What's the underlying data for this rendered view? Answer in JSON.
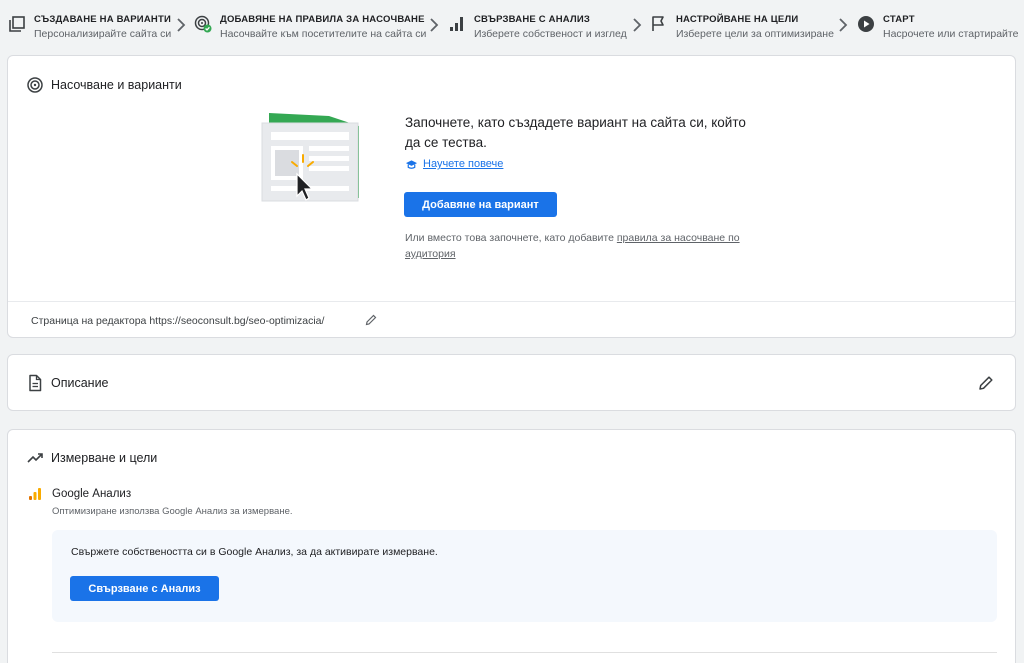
{
  "stepper": {
    "steps": [
      {
        "title": "СЪЗДАВАНЕ НА ВАРИАНТИ",
        "subtitle": "Персонализирайте сайта си",
        "icon": "variants-icon"
      },
      {
        "title": "ДОБАВЯНЕ НА ПРАВИЛА ЗА НАСОЧВАНЕ",
        "subtitle": "Насочвайте към посетителите на сайта си",
        "icon": "target-check-icon"
      },
      {
        "title": "СВЪРЗВАНЕ С АНАЛИЗ",
        "subtitle": "Изберете собственост и изглед",
        "icon": "bar-chart-icon"
      },
      {
        "title": "НАСТРОЙВАНЕ НА ЦЕЛИ",
        "subtitle": "Изберете цели за оптимизиране",
        "icon": "flag-icon"
      },
      {
        "title": "СТАРТ",
        "subtitle": "Насрочете или стартирайте",
        "icon": "play-icon"
      }
    ]
  },
  "targeting": {
    "title": "Насочване и варианти",
    "hero_text": "Започнете, като създадете вариант на сайта си, който да се тества.",
    "learn_more": "Научете повече",
    "add_variant_button": "Добавяне на вариант",
    "alt_text": "Или вместо това започнете, като добавите",
    "alt_link": "правила за насочване по аудитория",
    "editor_page": "Страница на редактора https://seoconsult.bg/seo-optimizacia/"
  },
  "description": {
    "title": "Описание"
  },
  "measurement": {
    "title": "Измерване и цели",
    "ga_title": "Google Анализ",
    "ga_subtitle": "Оптимизиране използва Google Анализ за измерване.",
    "ga_box_text": "Свържете собствеността си в Google Анализ, за да активирате измерване.",
    "link_button": "Свързване с Анализ"
  },
  "colors": {
    "primary": "#1a73e8",
    "success": "#34a853",
    "illustration_green": "#34a853",
    "analytics_orange": "#f9ab00",
    "analytics_yellow": "#e37400"
  }
}
